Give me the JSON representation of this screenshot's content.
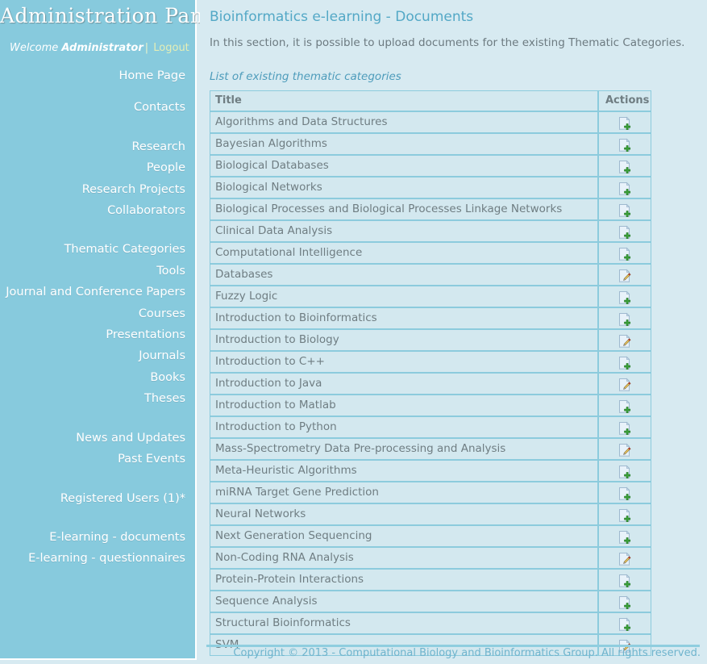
{
  "sidebar": {
    "panel_title": "Administration Panel",
    "welcome_prefix": "Welcome ",
    "admin_name": "Administrator",
    "separator": "|",
    "logout_label": "Logout",
    "items": [
      {
        "label": "Home Page",
        "gap_after": "sm"
      },
      {
        "label": "Contacts",
        "gap_after": "lg"
      },
      {
        "label": "Research",
        "gap_after": "none"
      },
      {
        "label": "People",
        "gap_after": "none"
      },
      {
        "label": "Research Projects",
        "gap_after": "none"
      },
      {
        "label": "Collaborators",
        "gap_after": "lg"
      },
      {
        "label": "Thematic Categories",
        "gap_after": "none"
      },
      {
        "label": "Tools",
        "gap_after": "none"
      },
      {
        "label": "Journal and Conference Papers",
        "gap_after": "none"
      },
      {
        "label": "Courses",
        "gap_after": "none"
      },
      {
        "label": "Presentations",
        "gap_after": "none"
      },
      {
        "label": "Journals",
        "gap_after": "none"
      },
      {
        "label": "Books",
        "gap_after": "none"
      },
      {
        "label": "Theses",
        "gap_after": "lg"
      },
      {
        "label": "News and Updates",
        "gap_after": "none"
      },
      {
        "label": "Past Events",
        "gap_after": "lg"
      },
      {
        "label": "Registered Users (1)*",
        "gap_after": "lg"
      },
      {
        "label": "E-learning - documents",
        "gap_after": "none"
      },
      {
        "label": "E-learning - questionnaires",
        "gap_after": "none"
      }
    ]
  },
  "main": {
    "title": "Bioinformatics e-learning - Documents",
    "description": "In this section, it is possible to upload documents for the existing Thematic Categories.",
    "list_caption": "List of existing thematic categories",
    "table": {
      "columns": [
        "Title",
        "Actions"
      ],
      "rows": [
        {
          "title": "Algorithms and Data Structures",
          "action": "add-document-icon"
        },
        {
          "title": "Bayesian Algorithms",
          "action": "add-document-icon"
        },
        {
          "title": "Biological Databases",
          "action": "add-document-icon"
        },
        {
          "title": "Biological Networks",
          "action": "add-document-icon"
        },
        {
          "title": "Biological Processes and Biological Processes Linkage Networks",
          "action": "add-document-icon"
        },
        {
          "title": "Clinical Data Analysis",
          "action": "add-document-icon"
        },
        {
          "title": "Computational Intelligence",
          "action": "add-document-icon"
        },
        {
          "title": "Databases",
          "action": "edit-document-icon"
        },
        {
          "title": "Fuzzy Logic",
          "action": "add-document-icon"
        },
        {
          "title": "Introduction to Bioinformatics",
          "action": "add-document-icon"
        },
        {
          "title": "Introduction to Biology",
          "action": "edit-document-icon"
        },
        {
          "title": "Introduction to C++",
          "action": "add-document-icon"
        },
        {
          "title": "Introduction to Java",
          "action": "edit-document-icon"
        },
        {
          "title": "Introduction to Matlab",
          "action": "add-document-icon"
        },
        {
          "title": "Introduction to Python",
          "action": "add-document-icon"
        },
        {
          "title": "Mass-Spectrometry Data Pre-processing and Analysis",
          "action": "edit-document-icon"
        },
        {
          "title": "Meta-Heuristic Algorithms",
          "action": "add-document-icon"
        },
        {
          "title": "miRNA Target Gene Prediction",
          "action": "add-document-icon"
        },
        {
          "title": "Neural Networks",
          "action": "add-document-icon"
        },
        {
          "title": "Next Generation Sequencing",
          "action": "add-document-icon"
        },
        {
          "title": "Non-Coding RNA Analysis",
          "action": "edit-document-icon"
        },
        {
          "title": "Protein-Protein Interactions",
          "action": "add-document-icon"
        },
        {
          "title": "Sequence Analysis",
          "action": "add-document-icon"
        },
        {
          "title": "Structural Bioinformatics",
          "action": "add-document-icon"
        },
        {
          "title": "SVM",
          "action": "edit-document-icon"
        }
      ]
    }
  },
  "footer": {
    "copyright": "Copyright © 2013 - Computational Biology and Bioinformatics Group. All rights reserved."
  },
  "colors": {
    "sidebar_bg": "#87cadd",
    "page_bg": "#d7eaf1",
    "table_border": "#8ccbdd",
    "title_accent": "#53a8c6",
    "text": "#6f7d82",
    "logout": "#e4eeb6",
    "footer_text": "#6fb4cd",
    "icon_green": "#3aa33a"
  }
}
